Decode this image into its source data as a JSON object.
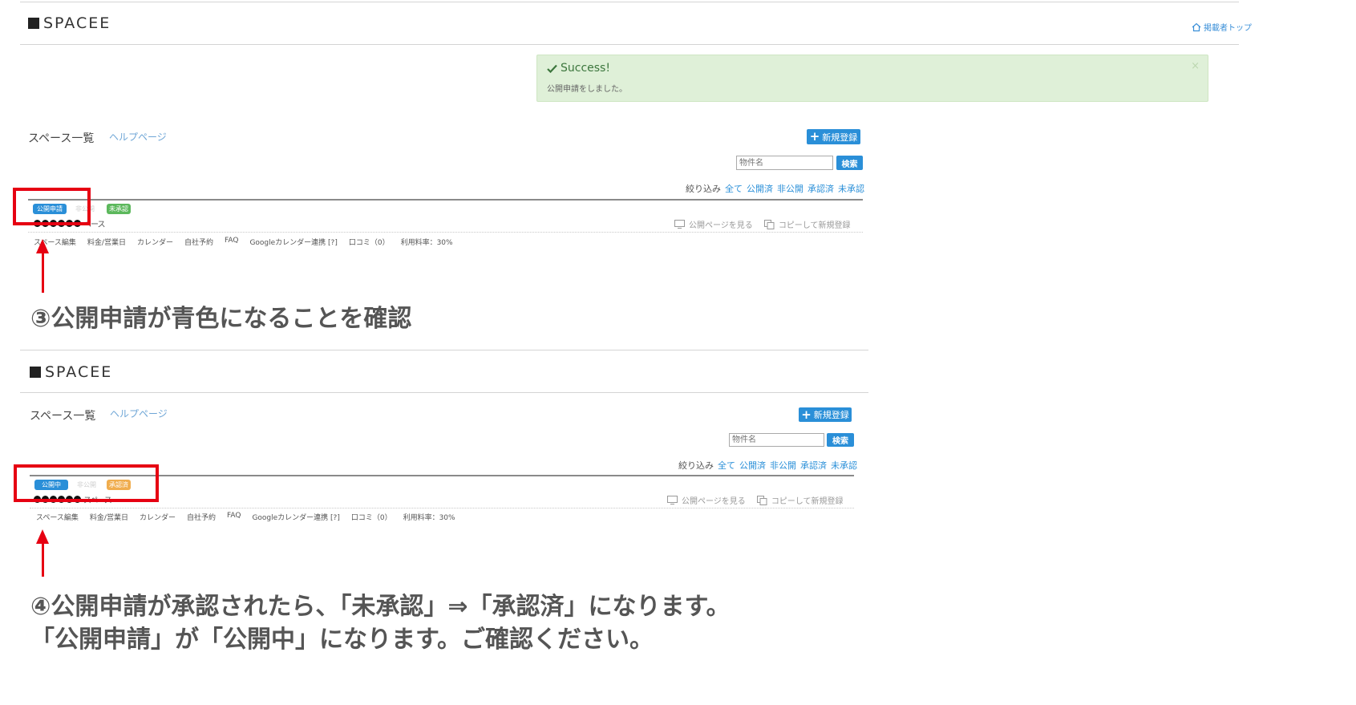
{
  "screens": [
    {
      "logo": "SPACEE",
      "top_link": "掲載者トップ",
      "alert": {
        "title": "Success!",
        "message": "公開申請をしました。",
        "close": "×"
      },
      "page_title": "スペース一覧",
      "help_link": "ヘルプページ",
      "new_button": "新規登録",
      "search_placeholder": "物件名",
      "search_button": "検索",
      "filter_label": "絞り込み",
      "filters": [
        "全て",
        "公開済",
        "非公開",
        "承認済",
        "未承認"
      ],
      "badges": [
        "公開申請",
        "非公開",
        "未承認"
      ],
      "space_suffix": "ペース",
      "actions": [
        "公開ページを見る",
        "コピーして新規登録"
      ],
      "menu": [
        "スペース編集",
        "料金/営業日",
        "カレンダー",
        "自社予約",
        "FAQ",
        "Googleカレンダー連携 [?]",
        "口コミ（0）",
        "利用料率：30%"
      ]
    },
    {
      "logo": "SPACEE",
      "page_title": "スペース一覧",
      "help_link": "ヘルプページ",
      "new_button": "新規登録",
      "search_placeholder": "物件名",
      "search_button": "検索",
      "filter_label": "絞り込み",
      "filters": [
        "全て",
        "公開済",
        "非公開",
        "承認済",
        "未承認"
      ],
      "badges": [
        "公開中",
        "非公開",
        "承認済"
      ],
      "space_suffix": "スペース",
      "actions": [
        "公開ページを見る",
        "コピーして新規登録"
      ],
      "menu": [
        "スペース編集",
        "料金/営業日",
        "カレンダー",
        "自社予約",
        "FAQ",
        "Googleカレンダー連携 [?]",
        "口コミ（0）",
        "利用料率：30%"
      ]
    }
  ],
  "annotations": {
    "step3": "③公開申請が青色になることを確認",
    "step4_line1": "④公開申請が承認されたら、「未承認」⇒「承認済」になります。",
    "step4_line2": "「公開申請」が「公開中」になります。ご確認ください。"
  },
  "colors": {
    "accent": "#2a8fd8",
    "success_bg": "#dff0d8",
    "highlight": "#e60012",
    "unapproved": "#5cb85c",
    "approved": "#f0ad4e"
  },
  "icons": [
    "check-icon",
    "home-icon",
    "plus-icon",
    "monitor-icon",
    "copy-icon",
    "arrow-up-icon"
  ]
}
